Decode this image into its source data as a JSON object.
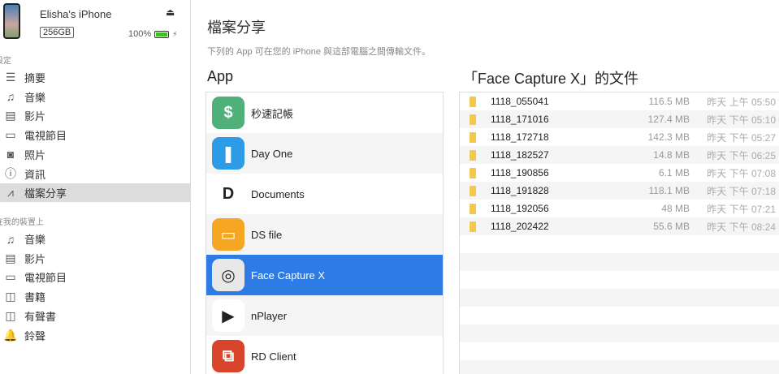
{
  "device": {
    "name": "Elisha's iPhone",
    "capacity": "256GB",
    "battery": "100%",
    "battery_level": 1.0
  },
  "sidebar": {
    "settings_header": "設定",
    "settings": [
      {
        "label": "摘要",
        "icon": "list-icon"
      },
      {
        "label": "音樂",
        "icon": "music-icon"
      },
      {
        "label": "影片",
        "icon": "film-icon"
      },
      {
        "label": "電視節目",
        "icon": "tv-icon"
      },
      {
        "label": "照片",
        "icon": "camera-icon"
      },
      {
        "label": "資訊",
        "icon": "info-icon"
      },
      {
        "label": "檔案分享",
        "icon": "app-store-icon",
        "selected": true
      }
    ],
    "device_header": "在我的裝置上",
    "device_items": [
      {
        "label": "音樂",
        "icon": "music-icon"
      },
      {
        "label": "影片",
        "icon": "film-icon"
      },
      {
        "label": "電視節目",
        "icon": "tv-icon"
      },
      {
        "label": "書籍",
        "icon": "book-icon"
      },
      {
        "label": "有聲書",
        "icon": "audiobook-icon"
      },
      {
        "label": "鈴聲",
        "icon": "bell-icon"
      }
    ]
  },
  "main": {
    "title": "檔案分享",
    "subtitle": "下列的 App 可在您的 iPhone 與這部電腦之間傳輸文件。",
    "apps_header": "App",
    "docs_header": "「Face Capture X」的文件",
    "apps": [
      {
        "name": "秒速記帳",
        "color": "#4fb07a",
        "glyph": "$"
      },
      {
        "name": "Day One",
        "color": "#2e9be6",
        "glyph": "❚"
      },
      {
        "name": "Documents",
        "color": "#ffffff",
        "glyph": "D"
      },
      {
        "name": "DS file",
        "color": "#f5a623",
        "glyph": "▭"
      },
      {
        "name": "Face Capture X",
        "color": "#e8e8e8",
        "glyph": "◎",
        "selected": true
      },
      {
        "name": "nPlayer",
        "color": "#ffffff",
        "glyph": "▶"
      },
      {
        "name": "RD Client",
        "color": "#d9452b",
        "glyph": "⧉"
      }
    ],
    "docs": [
      {
        "name": "1118_055041",
        "size": "116.5 MB",
        "date": "昨天 上午 05:50"
      },
      {
        "name": "1118_171016",
        "size": "127.4 MB",
        "date": "昨天 下午 05:10"
      },
      {
        "name": "1118_172718",
        "size": "142.3 MB",
        "date": "昨天 下午 05:27"
      },
      {
        "name": "1118_182527",
        "size": "14.8 MB",
        "date": "昨天 下午 06:25"
      },
      {
        "name": "1118_190856",
        "size": "6.1 MB",
        "date": "昨天 下午 07:08"
      },
      {
        "name": "1118_191828",
        "size": "118.1 MB",
        "date": "昨天 下午 07:18"
      },
      {
        "name": "1118_192056",
        "size": "48 MB",
        "date": "昨天 下午 07:21"
      },
      {
        "name": "1118_202422",
        "size": "55.6 MB",
        "date": "昨天 下午 08:24"
      }
    ]
  }
}
